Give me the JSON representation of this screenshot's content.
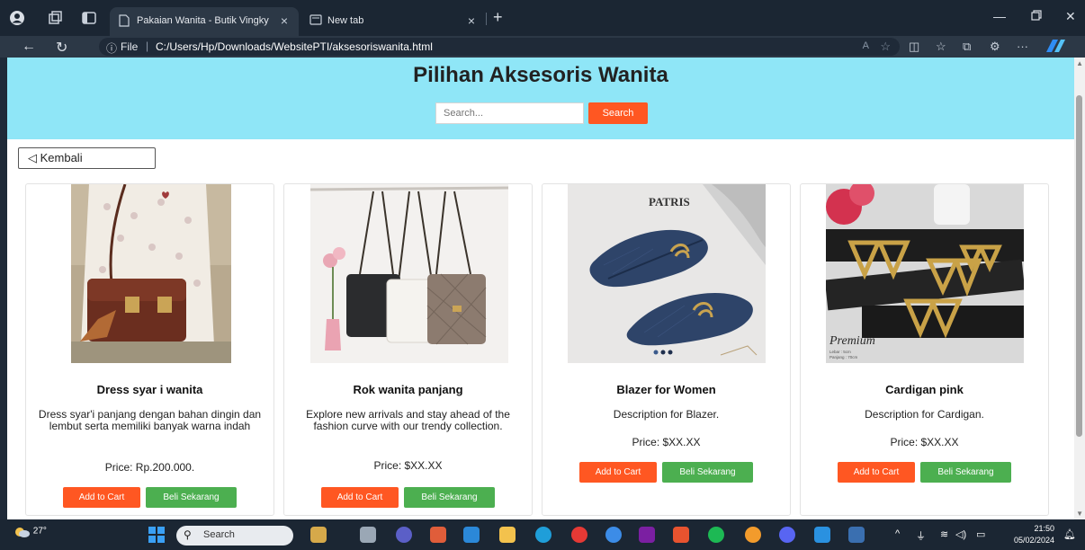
{
  "browser": {
    "tabs": [
      {
        "title": "Pakaian Wanita - Butik Vingky",
        "active": true
      },
      {
        "title": "New tab",
        "active": false
      }
    ],
    "address": {
      "info_icon": "info-icon",
      "scheme_label": "File",
      "url": "C:/Users/Hp/Downloads/WebsitePTI/aksesoriswanita.html"
    }
  },
  "page": {
    "title": "Pilihan Aksesoris Wanita",
    "search_placeholder": "Search...",
    "search_button": "Search",
    "back_button": "◁ Kembali"
  },
  "products": [
    {
      "title": "Dress syar i wanita",
      "description": "Dress syar'i panjang dengan bahan dingin dan lembut serta memiliki banyak warna indah",
      "price": "Price: Rp.200.000.",
      "add_to_cart": "Add to Cart",
      "buy_now": "Beli Sekarang"
    },
    {
      "title": "Rok wanita panjang",
      "description": "Explore new arrivals and stay ahead of the fashion curve with our trendy collection.",
      "price": "Price: $XX.XX",
      "add_to_cart": "Add to Cart",
      "buy_now": "Beli Sekarang"
    },
    {
      "title": "Blazer for Women",
      "description": "Description for Blazer.",
      "price": "Price: $XX.XX",
      "add_to_cart": "Add to Cart",
      "buy_now": "Beli Sekarang",
      "image_text": "PATRIS"
    },
    {
      "title": "Cardigan pink",
      "description": "Description for Cardigan.",
      "price": "Price: $XX.XX",
      "add_to_cart": "Add to Cart",
      "buy_now": "Beli Sekarang",
      "image_text": "Premium"
    }
  ],
  "taskbar": {
    "weather": "27°",
    "search_label": "Search",
    "time": "21:50",
    "date": "05/02/2024"
  },
  "colors": {
    "hero_bg": "#8fe6f7",
    "accent_orange": "#ff5722",
    "accent_green": "#4caf50"
  }
}
